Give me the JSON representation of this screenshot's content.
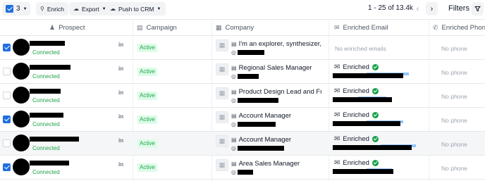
{
  "toolbar": {
    "selected_count": "3",
    "enrich_label": "Enrich",
    "export_label": "Export",
    "push_label": "Push to CRM",
    "pagination_text": "1 - 25 of 13.4k",
    "filters_label": "Filters"
  },
  "columns": {
    "prospect": "Prospect",
    "campaign": "Campaign",
    "company": "Company",
    "email": "Enriched Email",
    "phone": "Enriched Phone"
  },
  "colors": {
    "accent": "#1f6fde",
    "connected": "#22a34a",
    "active_badge_bg": "#dcfce7",
    "enriched_check": "#16a34a"
  },
  "rows": [
    {
      "checked": true,
      "status": "Connected",
      "linkedin": "in",
      "campaign": "Active",
      "title": "I'm an explorer, synthesizer, &...",
      "email_status": "No enriched emails",
      "phone": "No phone"
    },
    {
      "checked": false,
      "status": "Connected",
      "linkedin": "in",
      "campaign": "Active",
      "title": "Regional Sales Manager",
      "email_status": "Enriched",
      "phone": "No phone"
    },
    {
      "checked": false,
      "status": "Connected",
      "linkedin": "in",
      "campaign": "Active",
      "title": "Product Design Lead and Full ...",
      "email_status": "Enriched",
      "phone": "No phone"
    },
    {
      "checked": true,
      "status": "Connected",
      "linkedin": "in",
      "campaign": "Active",
      "title": "Account Manager",
      "email_status": "Enriched",
      "phone": "No phone"
    },
    {
      "checked": false,
      "status": "Connected",
      "linkedin": "in",
      "campaign": "Active",
      "title": "Account Manager",
      "email_status": "Enriched",
      "phone": "No phone"
    },
    {
      "checked": true,
      "status": "Connected",
      "linkedin": "in",
      "campaign": "Active",
      "title": "Area Sales Manager",
      "email_status": "Enriched",
      "phone": "No phone"
    }
  ]
}
